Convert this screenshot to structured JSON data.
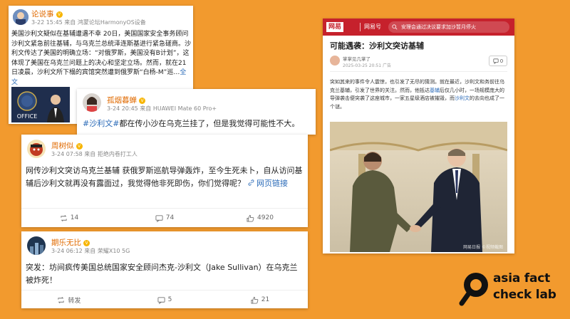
{
  "posts": [
    {
      "username": "论说事",
      "meta": "3-22 15:45 来自 鸿蒙论坛HarmonyOS设备",
      "text": "美国沙利文疑似在基辅遭遇不幸 20日，美国国家安全事务顾问沙利文紧急前往基辅，与乌克兰总统泽连斯基进行紧急磋商。沙利文传达了美国的明确立场：“对俄罗斯，美国没有B计划”，这体现了美国在乌克兰问题上的决心和坚定立场。然而，就在21日凌晨，沙利文所下榻的宾馆突然遭到俄罗斯“白杨-M”巡…",
      "link": "全文",
      "seal_text": "OFFICE"
    },
    {
      "username": "孤烟暮蝉",
      "meta": "3-24 20:45 来自 HUAWEI Mate 60 Pro+",
      "hashtag": "#沙利文#",
      "text": "都在传小沙在乌克兰挂了，但是我觉得可能性不大。"
    },
    {
      "username": "周树似",
      "meta": "3-24 07:58 来自 拒绝内卷打工人",
      "text": "网传沙利文突访乌克兰基辅 获俄罗斯巡航导弹轰炸，至今生死未卜，自从访问基辅后沙利文就再没有露面过，我觉得他非死即伤，你们觉得呢？",
      "link": "网页链接",
      "reposts": "14",
      "comments": "74",
      "likes": "4920"
    },
    {
      "username": "期乐无比",
      "meta": "3-24 06:12 来自 荣耀X10 5G",
      "text": "突发：坊间疯传美国总统国家安全顾问杰克-沙利文（Jake Sullivan）在乌克兰被炸死！",
      "reposts": "转发",
      "comments": "5",
      "likes": "21"
    }
  ],
  "article": {
    "logo": "网易",
    "channel": "网易号",
    "search_placeholder": "安理会通过决议要求加沙暂月停火",
    "title": "可能遇袭：沙利文突访基辅",
    "author": "掌掌见几掌了",
    "date": "2025-03-25 20:51 广告",
    "comment_count": "0",
    "body_before_link": "突如其来的事件令人震惊，也引发了无尽的猜测。就在最近，沙利文和务前往乌克兰基辅，引发了世界的关注。然而，他抵达",
    "body_link1": "基辅",
    "body_mid": "后仅几小时，一场规模庞大的导弹袭击便突袭了这座城市，一家五星级酒店被摧毁，而",
    "body_link2": "沙利文",
    "body_after": "的去向也成了一个谜。",
    "photo_watermark": "网易日报 ©视频截图"
  },
  "brand": {
    "line1": "asia fact",
    "line2": "check lab"
  },
  "colors": {
    "background": "#f29a2e",
    "username": "#e06a00",
    "link": "#2b6bb8",
    "netease_red": "#c6212c"
  }
}
